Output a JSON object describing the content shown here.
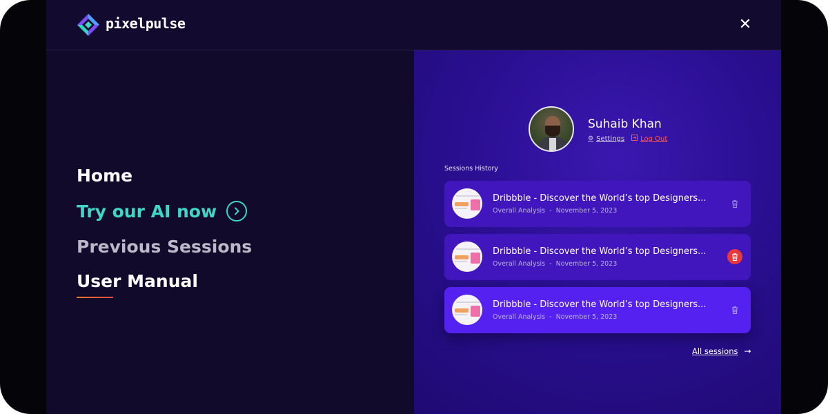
{
  "app": {
    "brand": "pixelpulse",
    "close_icon": "close-icon",
    "colors": {
      "accent_teal": "#3fd6c6",
      "accent_purple": "#5521f0",
      "danger": "#e83a3a",
      "underline_orange": "#f0762b"
    }
  },
  "nav": {
    "items": [
      {
        "label": "Home",
        "state": "default"
      },
      {
        "label": "Try our AI now",
        "state": "highlight",
        "icon": "chevron-right-circle-icon"
      },
      {
        "label": "Previous Sessions",
        "state": "muted"
      },
      {
        "label": "User Manual",
        "state": "active"
      }
    ]
  },
  "profile": {
    "name": "Suhaib Khan",
    "settings_label": "Settings",
    "settings_icon": "gear-icon",
    "logout_label": "Log Out",
    "logout_icon": "logout-icon"
  },
  "sessions": {
    "title": "Sessions History",
    "items": [
      {
        "title": "Dribbble - Discover the World’s top Designers...",
        "type": "Overall Analysis",
        "separator": "-",
        "date": "November 5, 2023",
        "trash_state": "default"
      },
      {
        "title": "Dribbble - Discover the World’s top Designers...",
        "type": "Overall Analysis",
        "separator": "-",
        "date": "November 5, 2023",
        "trash_state": "hover-danger"
      },
      {
        "title": "Dribbble - Discover the World’s top Designers...",
        "type": "Overall Analysis",
        "separator": "-",
        "date": "November 5, 2023",
        "trash_state": "default",
        "selected": true
      }
    ],
    "all_label": "All sessions",
    "all_icon": "arrow-right-icon"
  }
}
